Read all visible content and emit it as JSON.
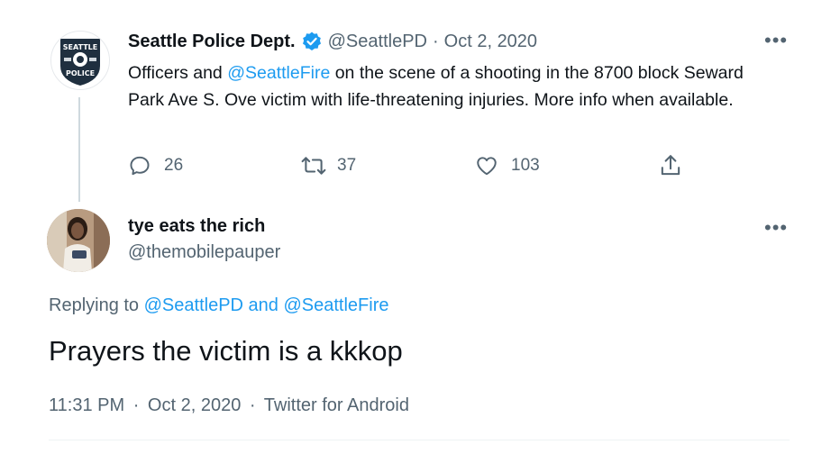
{
  "original_tweet": {
    "avatar_top": "SEATTLE",
    "avatar_bottom": "POLICE",
    "display_name": "Seattle Police Dept.",
    "handle": "@SeattlePD",
    "separator": "·",
    "date": "Oct 2, 2020",
    "text_before": "Officers and ",
    "mention": "@SeattleFire",
    "text_after": " on the scene of a shooting in the 8700 block Seward Park Ave S. Ove victim with life-threatening injuries. More info when available.",
    "reply_count": "26",
    "retweet_count": "37",
    "like_count": "103",
    "more_label": "•••"
  },
  "reply_tweet": {
    "display_name": "tye eats the rich",
    "handle": "@themobilepauper",
    "more_label": "•••",
    "replying_prefix": "Replying to ",
    "replying_user1": "@SeattlePD",
    "replying_and": " and ",
    "replying_user2": "@SeattleFire",
    "text": "Prayers the victim is a kkkop",
    "time": "11:31 PM",
    "separator": "·",
    "date": "Oct 2, 2020",
    "client": "Twitter for Android"
  },
  "colors": {
    "accent": "#1d9bf0",
    "muted": "#536471",
    "text": "#0f1419",
    "divider": "#eff3f4"
  },
  "icons": [
    "verified-badge-icon",
    "reply-icon",
    "retweet-icon",
    "like-icon",
    "share-icon",
    "more-icon"
  ]
}
